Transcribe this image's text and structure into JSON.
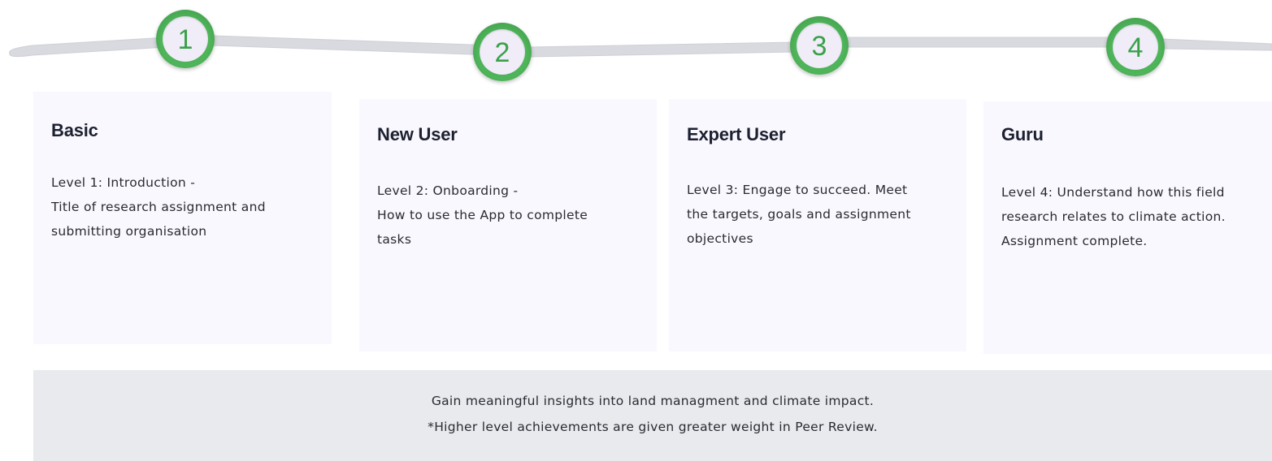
{
  "steps": [
    {
      "number": "1",
      "title": "Basic",
      "lines": [
        "Level 1: Introduction -",
        "Title of research assignment and",
        "submitting organisation"
      ]
    },
    {
      "number": "2",
      "title": "New User",
      "lines": [
        "Level 2: Onboarding -",
        "How to use the App to complete",
        "tasks"
      ]
    },
    {
      "number": "3",
      "title": "Expert User",
      "lines": [
        "Level 3: Engage to succeed. Meet",
        "the targets, goals and assignment",
        "objectives"
      ]
    },
    {
      "number": "4",
      "title": "Guru",
      "lines": [
        "Level 4: Understand how this field",
        "research relates to climate action.",
        "Assignment complete."
      ]
    }
  ],
  "footer": {
    "line1": "Gain meaningful insights into land managment and climate impact.",
    "line2": "*Higher level achievements are given greater weight in Peer Review."
  },
  "colors": {
    "marker_ring": "#4fb55a",
    "marker_fill": "#f1edf8",
    "marker_number": "#3aa14a",
    "track": "#d9dae0",
    "card_bg": "#f9f8fe",
    "footer_bg": "#e9eaed"
  }
}
